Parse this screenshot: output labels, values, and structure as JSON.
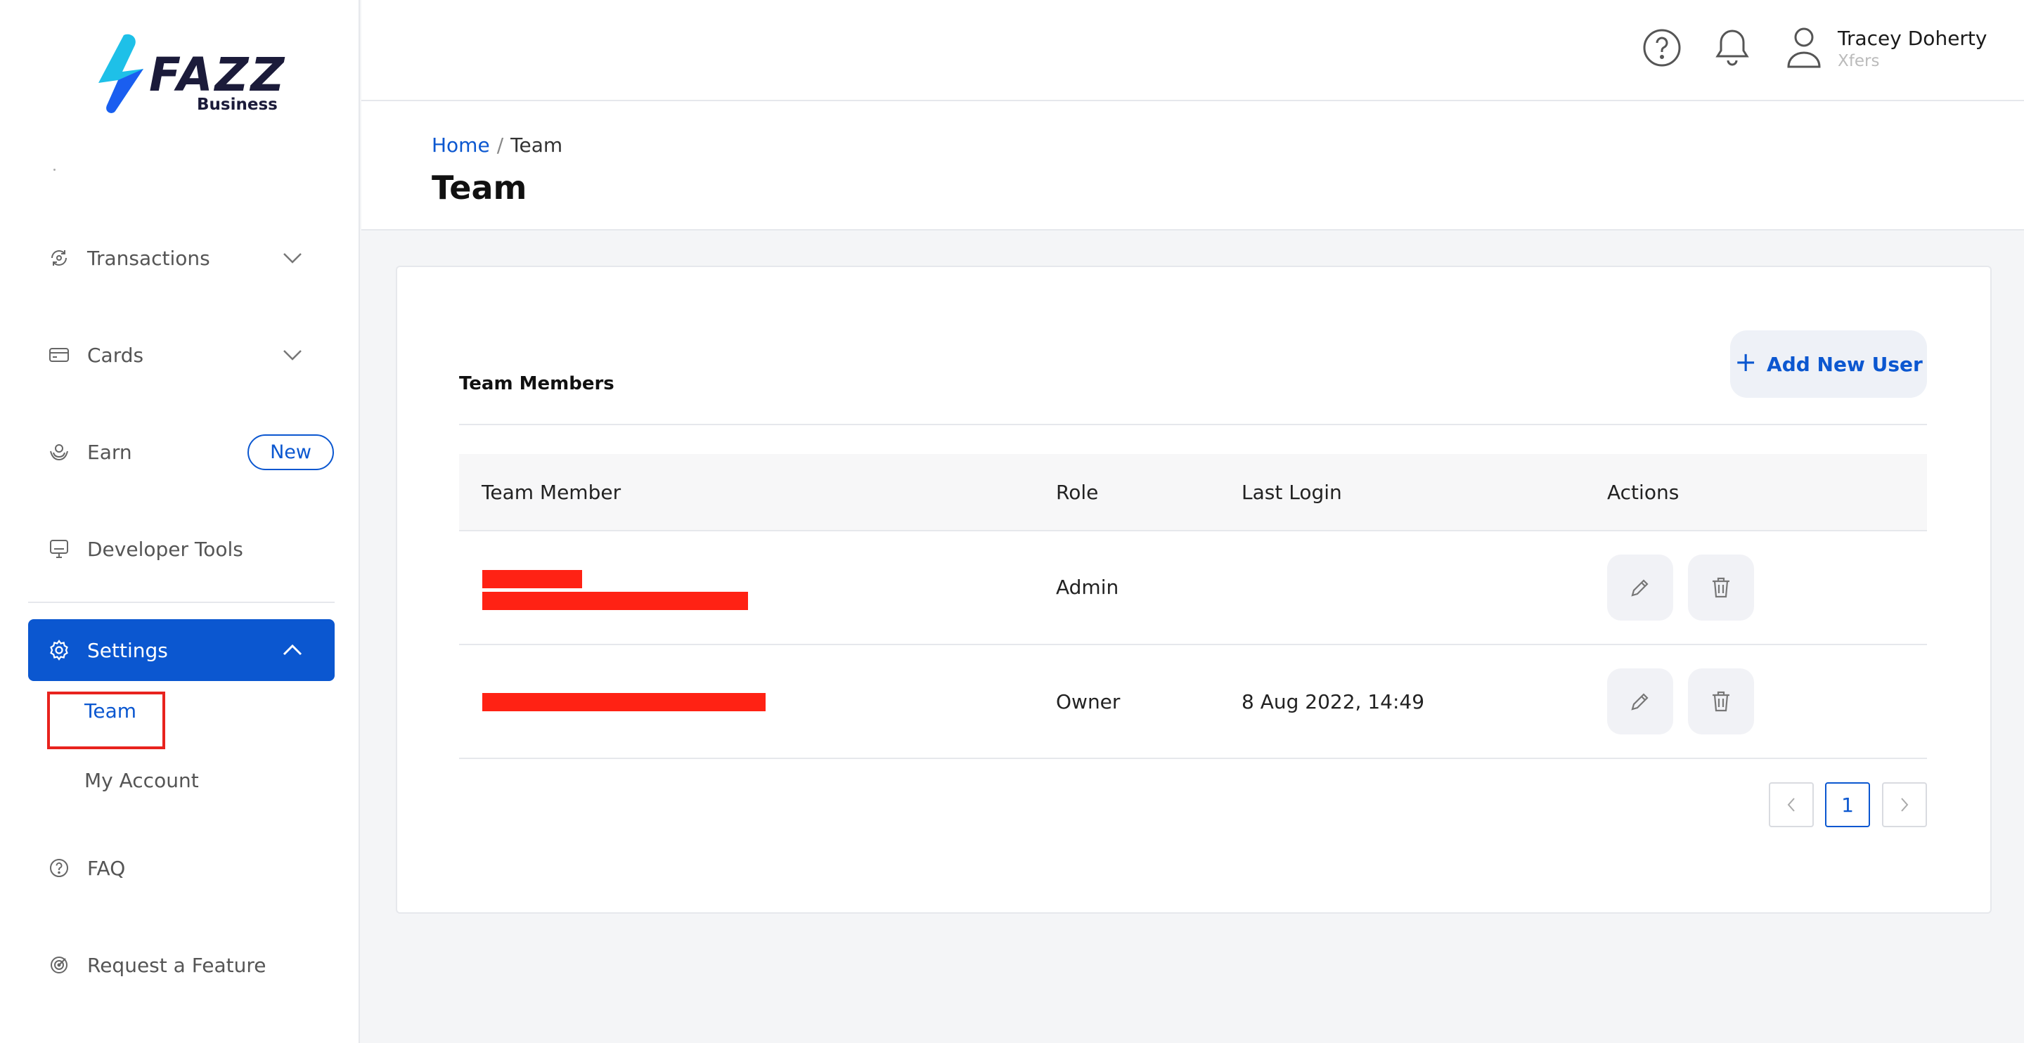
{
  "brand": {
    "logo_text": "FAZZ",
    "logo_sub": "Business"
  },
  "sidebar": {
    "items": [
      {
        "label": "Transactions",
        "icon": "transactions-icon"
      },
      {
        "label": "Cards",
        "icon": "card-icon"
      },
      {
        "label": "Earn",
        "icon": "earn-icon",
        "badge": "New"
      },
      {
        "label": "Developer Tools",
        "icon": "monitor-icon"
      },
      {
        "label": "Settings",
        "icon": "gear-icon",
        "active": true
      }
    ],
    "settings_sub": {
      "team": "Team",
      "my_account": "My Account"
    },
    "faq": "FAQ",
    "request_feature": "Request a Feature"
  },
  "header": {
    "user_name": "Tracey Doherty",
    "user_org": "Xfers",
    "icons": [
      "help-icon",
      "bell-icon",
      "user-icon"
    ]
  },
  "breadcrumb": {
    "home": "Home",
    "separator": "/",
    "current": "Team"
  },
  "page_title": "Team",
  "card": {
    "title": "Team Members",
    "add_button": "Add New User",
    "columns": [
      "Team Member",
      "Role",
      "Last Login",
      "Actions"
    ],
    "rows": [
      {
        "role": "Admin",
        "last_login": ""
      },
      {
        "role": "Owner",
        "last_login": "8 Aug 2022, 14:49"
      }
    ]
  },
  "pagination": {
    "current": "1"
  },
  "colors": {
    "accent": "#0b57d0",
    "redaction": "#ff2214",
    "highlight": "#e8231e"
  }
}
